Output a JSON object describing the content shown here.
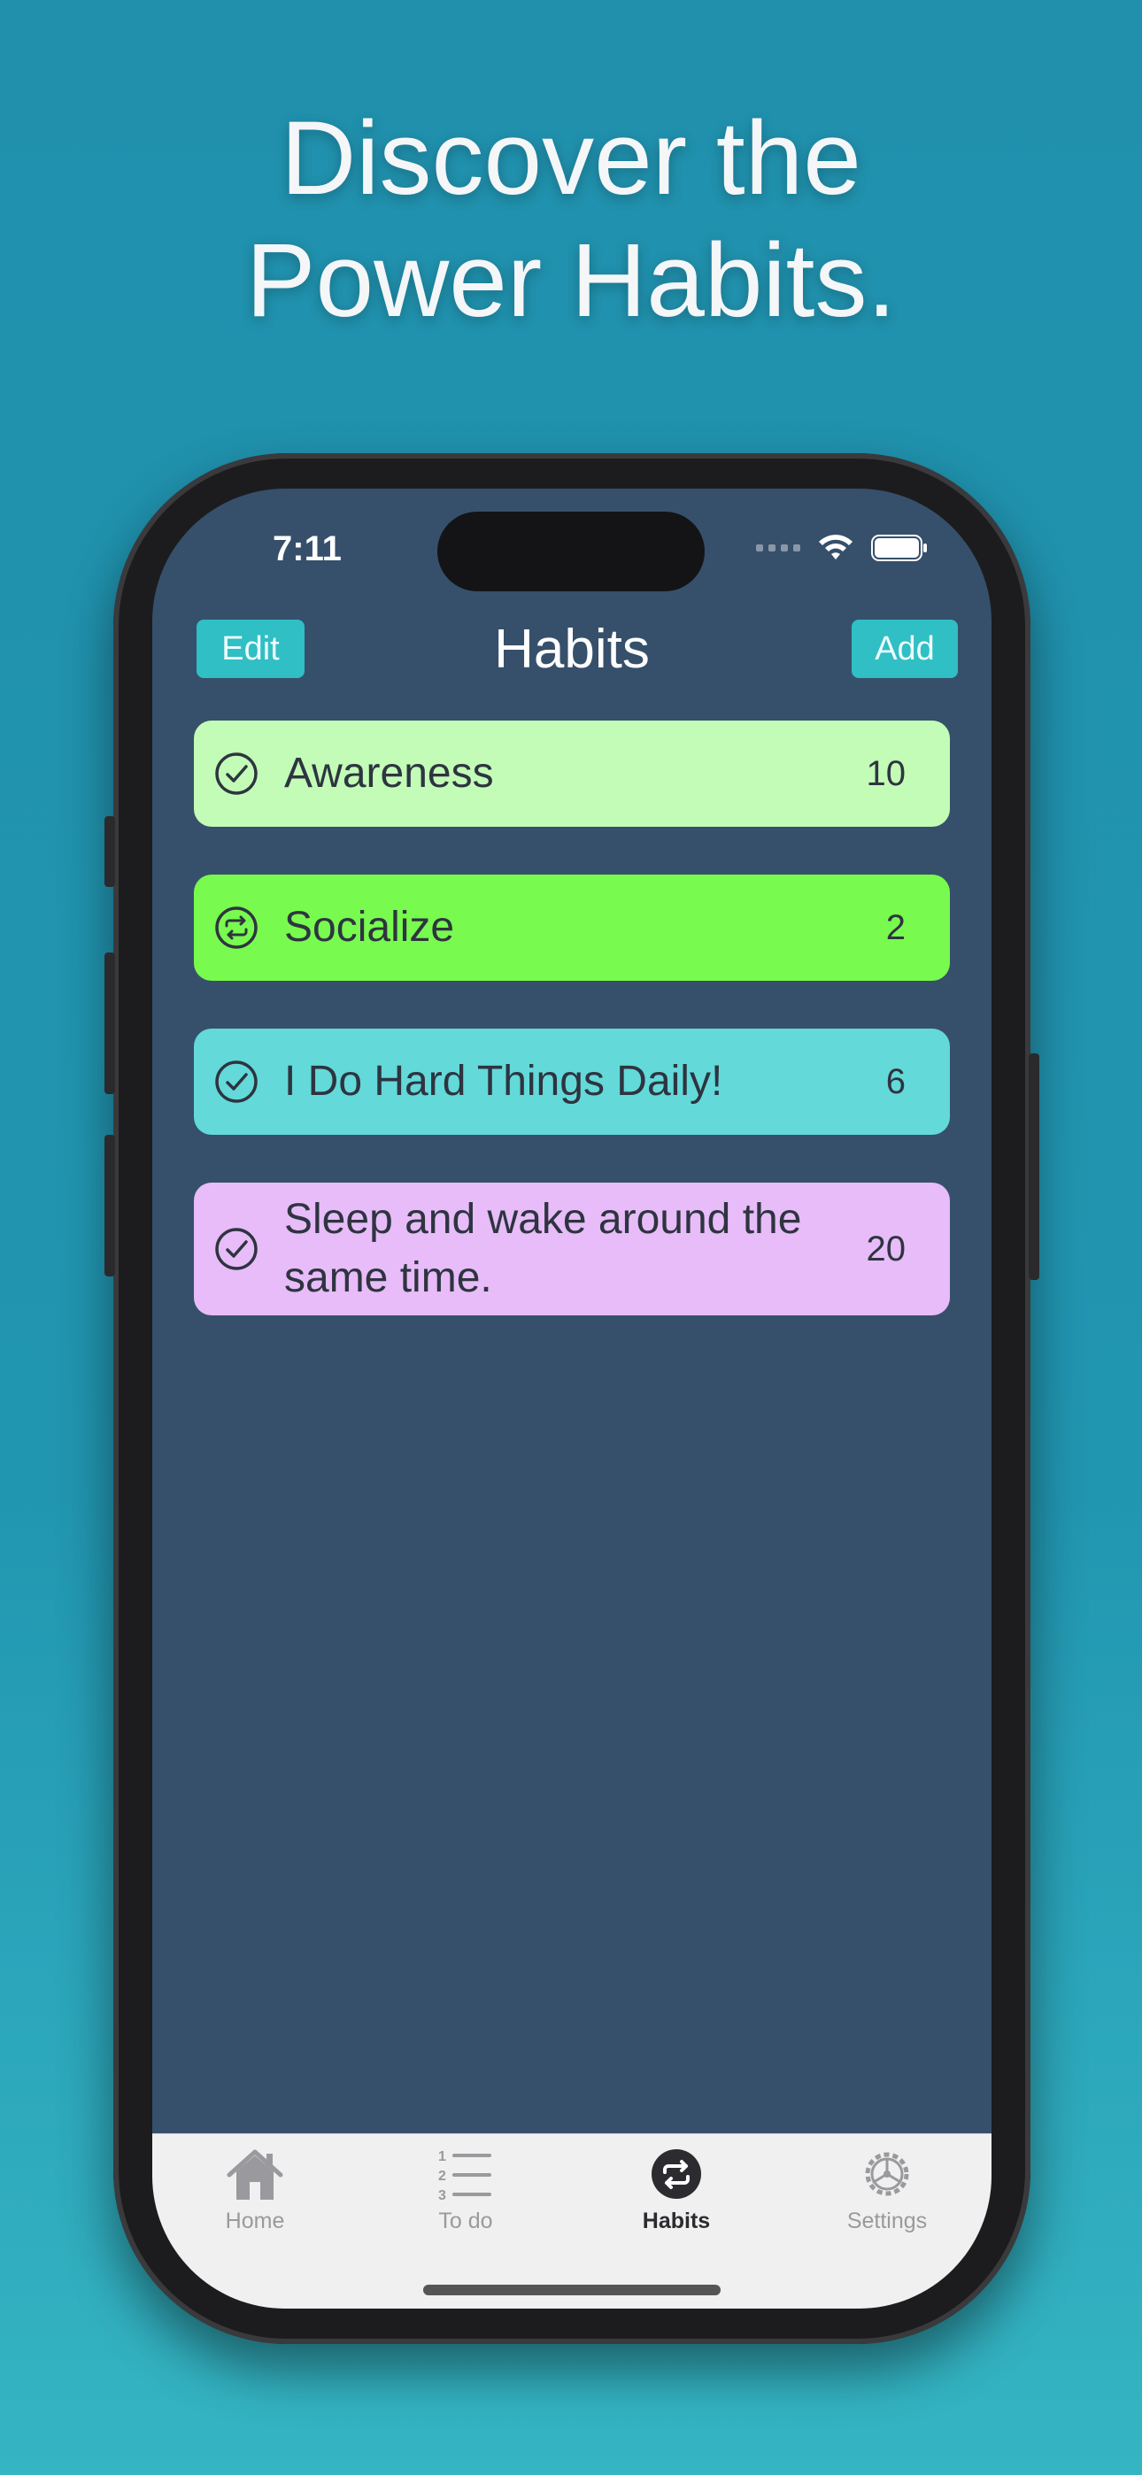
{
  "headline": {
    "line1": "Discover the",
    "line2": "Power Habits."
  },
  "status_bar": {
    "time": "7:11"
  },
  "nav": {
    "edit_label": "Edit",
    "title": "Habits",
    "add_label": "Add"
  },
  "habits": [
    {
      "label": "Awareness",
      "count": "10",
      "icon": "check-circle-icon",
      "color": "#c2fcb6"
    },
    {
      "label": "Socialize",
      "count": "2",
      "icon": "repeat-circle-icon",
      "color": "#78fa4e"
    },
    {
      "label": "I Do Hard Things Daily!",
      "count": "6",
      "icon": "check-circle-icon",
      "color": "#63d9d9"
    },
    {
      "label": "Sleep and wake around the same time.",
      "count": "20",
      "icon": "check-circle-icon",
      "color": "#e7bcf8"
    }
  ],
  "tabs": [
    {
      "label": "Home",
      "icon": "house-icon",
      "active": false
    },
    {
      "label": "To do",
      "icon": "numbered-list-icon",
      "active": false
    },
    {
      "label": "Habits",
      "icon": "repeat-circle-icon",
      "active": true
    },
    {
      "label": "Settings",
      "icon": "gear-icon",
      "active": false
    }
  ],
  "colors": {
    "background": "#2090ad",
    "screen": "#36506b",
    "accent_button": "#2fbfc4"
  }
}
